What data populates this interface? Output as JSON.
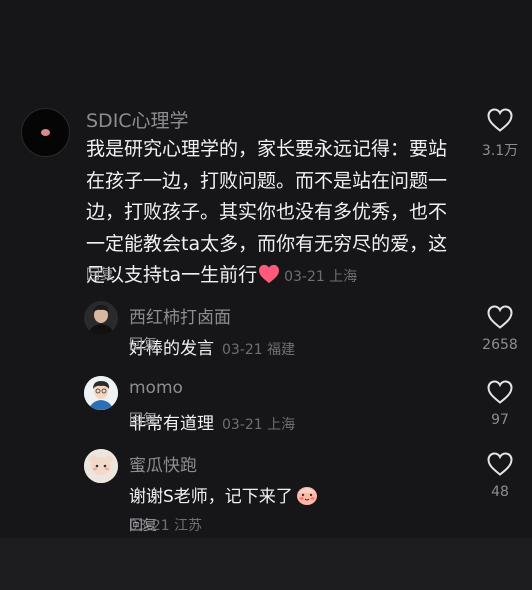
{
  "main_comment": {
    "username": "SDIC心理学",
    "text": "我是研究心理学的，家长要永远记得：要站在孩子一边，打败问题。而不是站在问题一边，打败孩子。其实你也没有多优秀，也不一定能教会ta太多，而你有无穷尽的爱，这足以支持ta一生前行",
    "date": "03-21",
    "location": "上海",
    "reply_label": "回复",
    "like_count": "3.1万"
  },
  "replies": [
    {
      "username": "西红柿打卤面",
      "text": "好棒的发言",
      "date": "03-21",
      "location": "福建",
      "reply_label": "回复",
      "like_count": "2658"
    },
    {
      "username": "momo",
      "text": "非常有道理",
      "date": "03-21",
      "location": "上海",
      "reply_label": "回复",
      "like_count": "97"
    },
    {
      "username": "蜜瓜快跑",
      "text": "谢谢S老师，记下来了",
      "date": "03-21",
      "location": "江苏",
      "reply_label": "回复",
      "like_count": "48"
    }
  ],
  "colors": {
    "background": "#161618",
    "primary_text": "#f1f1f1",
    "secondary_text": "#8d8d91",
    "meta_text": "#6e6e73",
    "heart_emoji": "#ff4d6d"
  },
  "icons": {
    "like": "heart-outline-icon",
    "inline_emoji": "pink-heart-icon",
    "reply_emoji": "blushing-face-icon"
  }
}
